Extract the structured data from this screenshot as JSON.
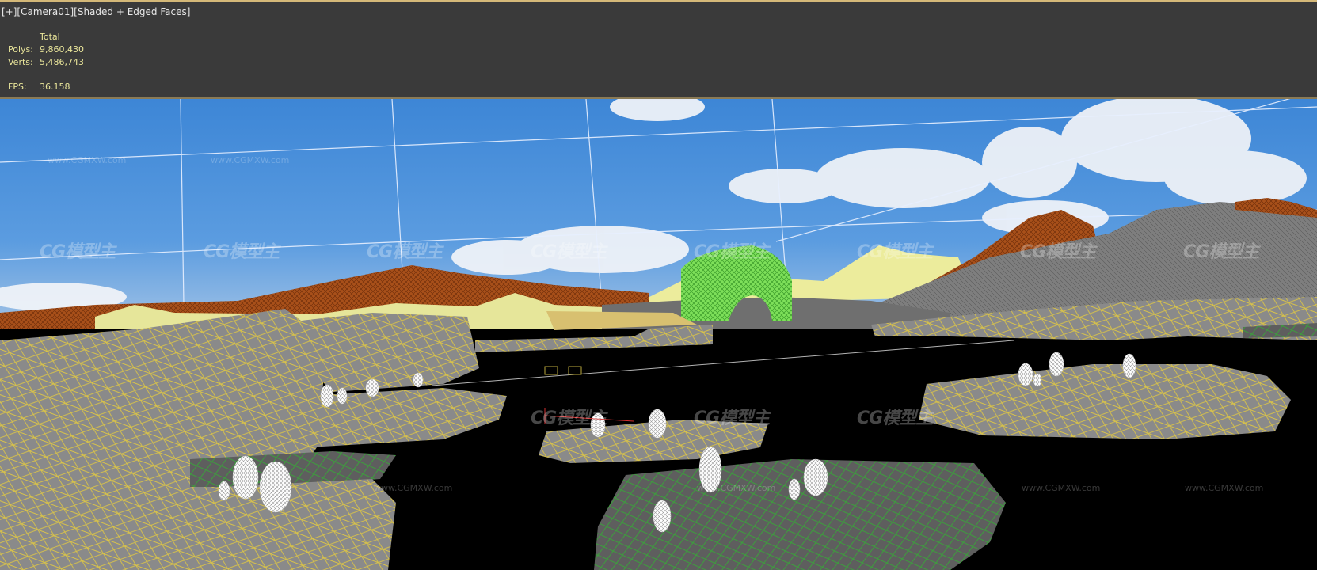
{
  "viewport": {
    "label_parts": [
      "[+]",
      "[Camera01]",
      "[Shaded + Edged Faces]"
    ]
  },
  "stats": {
    "header": "Total",
    "polys_label": "Polys:",
    "polys_value": "9,860,430",
    "verts_label": "Verts:",
    "verts_value": "5,486,743",
    "fps_label": "FPS:",
    "fps_value": "36.158"
  },
  "watermark": {
    "logo_text": "CG模型主",
    "site_text": "www.CGMXW.com"
  },
  "colors": {
    "header_bg": "#3a3a3a",
    "stat_text": "#e9e59a",
    "sky": "#4a8fd8",
    "wire_yellow": "#e0c84a",
    "wire_green": "#3aa33a",
    "rock_grey": "#7d7d7d",
    "mountain_brown": "#a34a12",
    "dune_yellow": "#e8e89a"
  }
}
